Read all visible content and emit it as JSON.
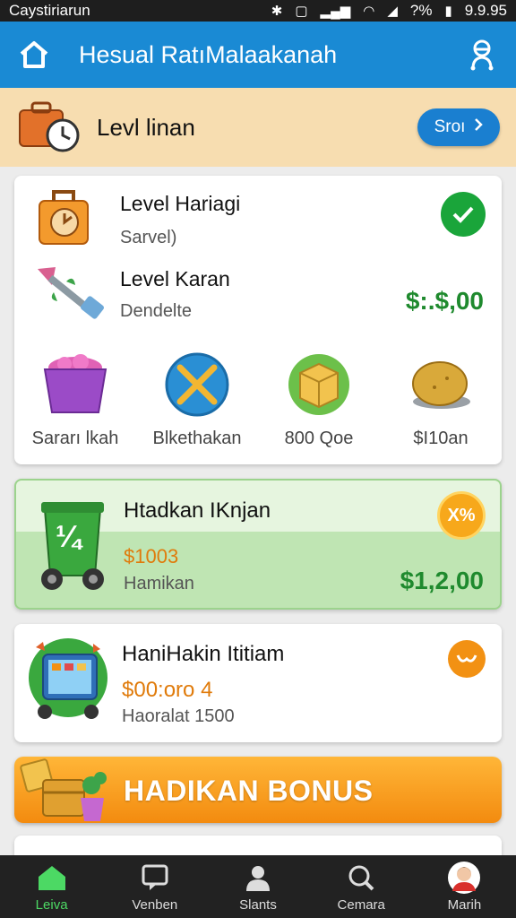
{
  "status_bar": {
    "carrier": "Caystiriarun",
    "battery": "?%",
    "time": "9.9.95"
  },
  "app_bar": {
    "title": "Hesual RatıMalaakanah",
    "home_icon": "home-icon",
    "profile_icon": "profile-icon"
  },
  "banner": {
    "title": "Levl linan",
    "button_label": "Sroı",
    "icon": "suitcase-clock-icon"
  },
  "level_card": {
    "rows": [
      {
        "title": "Level Hariagi",
        "subtitle": "Sarvel)",
        "icon": "bag-clock-icon",
        "status_icon": "check-icon"
      },
      {
        "title": "Level Karan",
        "subtitle": "Dendelte",
        "price": "$:.$,00",
        "icon": "arrow-hammer-icon"
      }
    ],
    "items": [
      {
        "label": "Sararı lkah",
        "icon": "purple-basket-icon"
      },
      {
        "label": "Blkethakan",
        "icon": "crossed-tools-icon"
      },
      {
        "label": "800 Qoe",
        "icon": "box-icon"
      },
      {
        "label": "$I10an",
        "icon": "bread-icon"
      }
    ]
  },
  "offer_card": {
    "title": "Htadkan IKnjan",
    "price_orange": "$1003",
    "subtitle": "Hamikan",
    "price": "$1,2,00",
    "badge": "X%",
    "icon_text": "¼",
    "icon": "trash-cart-icon"
  },
  "hanihakin_card": {
    "title": "HaniHakin Ititiam",
    "price_orange": "$00:oro 4",
    "subtitle": "Haoralat 1500",
    "icon": "tablet-cart-icon",
    "badge_icon": "bow-icon"
  },
  "bonus": {
    "label": "HADIKAN BONUS",
    "icon": "gift-boxes-icon"
  },
  "bottom_nav": [
    {
      "label": "Leiva",
      "icon": "home-icon",
      "active": true
    },
    {
      "label": "Venben",
      "icon": "chat-icon",
      "active": false
    },
    {
      "label": "Slants",
      "icon": "person-icon",
      "active": false
    },
    {
      "label": "Cemara",
      "icon": "search-icon",
      "active": false
    },
    {
      "label": "Marih",
      "icon": "avatar",
      "active": false
    }
  ],
  "colors": {
    "accent": "#1a8ad4",
    "success": "#1aa53a",
    "price_green": "#1f8a2e",
    "orange": "#f38b0f",
    "banner_bg": "#f7ddb0"
  }
}
